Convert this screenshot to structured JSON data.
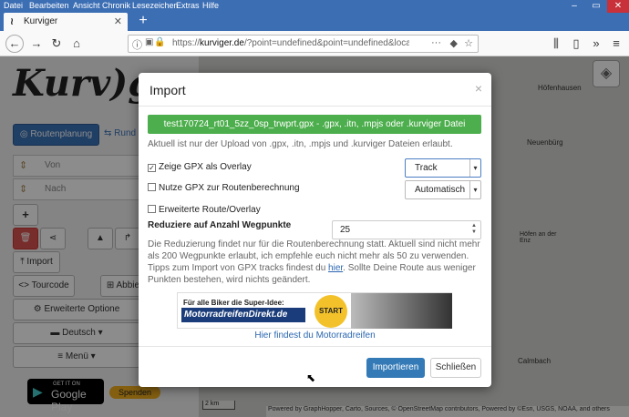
{
  "browser": {
    "menu": [
      "Datei",
      "Bearbeiten",
      "Ansicht",
      "Chronik",
      "Lesezeichen",
      "Extras",
      "Hilfe"
    ],
    "tab_title": "Kurviger",
    "url_host": "kurviger.de",
    "url_prefix": "https://",
    "url_path": "/?point=undefined&point=undefined&locale=d"
  },
  "sidebar": {
    "logo": "Kurv)go",
    "routenplanung": "Routenplanung",
    "rundtour": "Rund",
    "von": "Von",
    "nach": "Nach",
    "import": "Import",
    "tourcode": "Tourcode",
    "abbiege": "Abbie",
    "erweiterte": "Erweiterte Optione",
    "deutsch": "Deutsch",
    "menu": "Menü",
    "gplay_small": "GET IT ON",
    "gplay_big": "Google Play",
    "spenden": "Spenden"
  },
  "map": {
    "labels": [
      "Höfenhausen",
      "Neuenbürg",
      "Calmbach",
      "Höfen an der Enz"
    ],
    "scale": "2 km",
    "attribution": "Powered by GraphHopper, Carto, Sources, © OpenStreetMap contributors, Powered by ©Esri, USGS, NOAA, and others"
  },
  "modal": {
    "title": "Import",
    "close_x": "×",
    "file_button": "test170724_rt01_5zz_0sp_trwprt.gpx - .gpx, .itn, .mpjs oder .kurviger Datei",
    "hint": "Aktuell ist nur der Upload von .gpx, .itn, .mpjs und .kurviger Dateien erlaubt.",
    "cb_overlay": "Zeige GPX als Overlay",
    "cb_overlay_checked": true,
    "cb_routing": "Nutze GPX zur Routenberechnung",
    "cb_routing_checked": false,
    "cb_extended": "Erweiterte Route/Overlay",
    "cb_extended_checked": false,
    "select_type": "Track",
    "select_mode": "Automatisch",
    "reduce_label": "Reduziere auf Anzahl Wegpunkte",
    "reduce_value": "25",
    "desc_1": "Die Reduzierung findet nur für die Routenberechnung statt. Aktuell sind nicht mehr als 200 Wegpunkte erlaubt, ich empfehle euch nicht mehr als 50 zu verwenden. Tipps zum Import von GPX tracks findest du ",
    "desc_link": "hier",
    "desc_2": ". Sollte Deine Route aus weniger Punkten bestehen, wird nichts geändert.",
    "banner_line1": "Für alle Biker die Super-Idee:",
    "banner_line2": "MotorradreifenDirekt.de",
    "banner_start": "START",
    "reifen_link": "Hier findest du Motorradreifen",
    "import_button": "Importieren",
    "close_button": "Schließen"
  }
}
